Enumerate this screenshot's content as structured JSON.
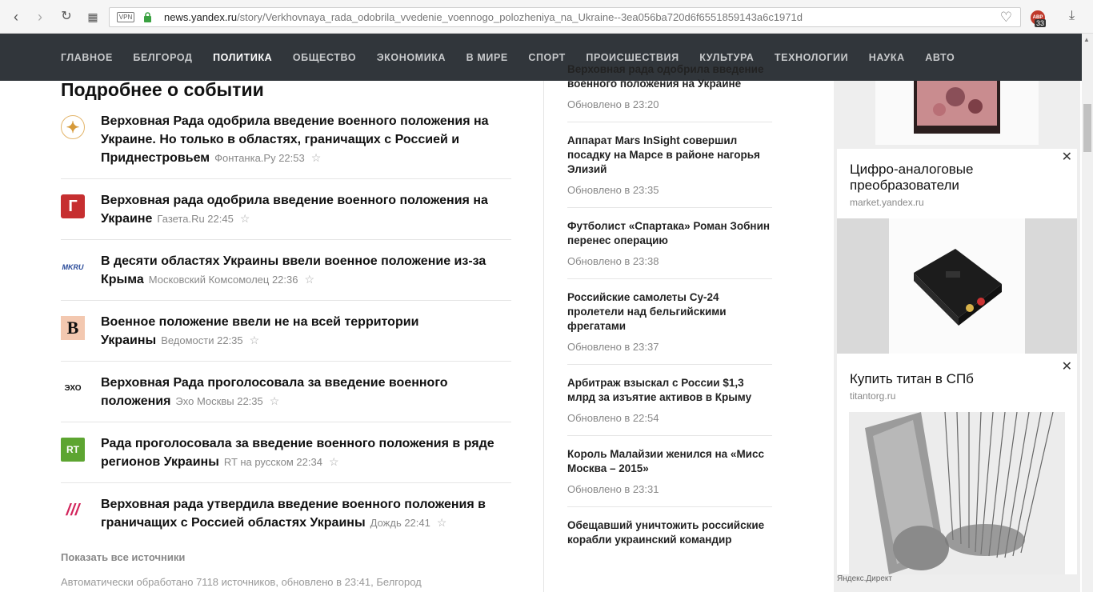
{
  "browser": {
    "vpn": "VPN",
    "url_host": "news.yandex.ru",
    "url_path": "/story/Verkhovnaya_rada_odobrila_vvedenie_voennogo_polozheniya_na_Ukraine--3ea056ba720d6f6551859143a6c1971d",
    "ext_label": "ABP",
    "ext_count": "33"
  },
  "nav": {
    "items": [
      "ГЛАВНОЕ",
      "БЕЛГОРОД",
      "ПОЛИТИКА",
      "ОБЩЕСТВО",
      "ЭКОНОМИКА",
      "В МИРЕ",
      "СПОРТ",
      "ПРОИСШЕСТВИЯ",
      "КУЛЬТУРА",
      "ТЕХНОЛОГИИ",
      "НАУКА",
      "АВТО"
    ],
    "active": "ПОЛИТИКА"
  },
  "main": {
    "title": "Подробнее о событии",
    "news": [
      {
        "title": "Верховная Рада одобрила введение военного положения на Украине. Но только в областях, граничащих с Россией и Приднестровьем",
        "source": "Фонтанка.Ру 22:53"
      },
      {
        "title": "Верховная рада одобрила введение военного положения на Украине",
        "source": "Газета.Ru 22:45",
        "logo": "Г"
      },
      {
        "title": "В десяти областях Украины ввели военное положение из-за Крыма",
        "source": "Московский Комсомолец 22:36",
        "logo": "MKRU"
      },
      {
        "title": "Военное положение ввели не на всей территории Украины",
        "source": "Ведомости 22:35",
        "logo": "B"
      },
      {
        "title": "Верховная Рада проголосовала за введение военного положения",
        "source": "Эхо Москвы 22:35",
        "logo": "ЭХО"
      },
      {
        "title": "Рада проголосовала за введение военного положения в ряде регионов Украины",
        "source": "RT на русском 22:34",
        "logo": "RT"
      },
      {
        "title": "Верховная рада утвердила введение военного положения в граничащих с Россией областях Украины",
        "source": "Дождь 22:41",
        "logo": "///"
      }
    ],
    "show_all": "Показать все источники",
    "auto_text": "Автоматически обработано 7118 источников, обновлено в 23:41, Белгород"
  },
  "mid": {
    "items": [
      {
        "title": "Верховная рада одобрила введение военного положения на Украине",
        "time": "Обновлено в 23:20"
      },
      {
        "title": "Аппарат Mars InSight совершил посадку на Марсе в районе нагорья Элизий",
        "time": "Обновлено в 23:35"
      },
      {
        "title": "Футболист «Спартака» Роман Зобнин перенес операцию",
        "time": "Обновлено в 23:38"
      },
      {
        "title": "Российские самолеты Су-24 пролетели над бельгийскими фрегатами",
        "time": "Обновлено в 23:37"
      },
      {
        "title": "Арбитраж взыскал с России $1,3 млрд за изъятие активов в Крыму",
        "time": "Обновлено в 22:54"
      },
      {
        "title": "Король Малайзии женился на «Мисс Москва – 2015»",
        "time": "Обновлено в 23:31"
      },
      {
        "title": "Обещавший уничтожить российские корабли украинский командир",
        "time": ""
      }
    ]
  },
  "ads": {
    "ad1": {
      "title": "Цифро-аналоговые преобразователи",
      "domain": "market.yandex.ru"
    },
    "ad2": {
      "title": "Купить титан в СПб",
      "domain": "titantorg.ru"
    },
    "footer": "Яндекс.Директ",
    "close": "✕"
  }
}
